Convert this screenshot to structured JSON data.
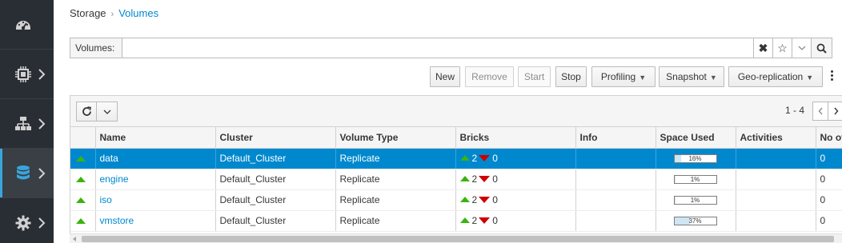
{
  "breadcrumb": {
    "parent": "Storage",
    "current": "Volumes"
  },
  "search": {
    "label": "Volumes:",
    "value": "",
    "placeholder": ""
  },
  "toolbar": {
    "new": "New",
    "remove": "Remove",
    "start": "Start",
    "stop": "Stop",
    "profiling": "Profiling",
    "snapshot": "Snapshot",
    "geo": "Geo-replication"
  },
  "pager": {
    "range": "1 - 4"
  },
  "columns": {
    "name": "Name",
    "cluster": "Cluster",
    "type": "Volume Type",
    "bricks": "Bricks",
    "info": "Info",
    "space": "Space Used",
    "activities": "Activities",
    "noof": "No of"
  },
  "rows": [
    {
      "name": "data",
      "cluster": "Default_Cluster",
      "type": "Replicate",
      "bricks_up": "2",
      "bricks_down": "0",
      "space": "16%",
      "space_fraction": 0.16,
      "noof": "0"
    },
    {
      "name": "engine",
      "cluster": "Default_Cluster",
      "type": "Replicate",
      "bricks_up": "2",
      "bricks_down": "0",
      "space": "1%",
      "space_fraction": 0.01,
      "noof": "0"
    },
    {
      "name": "iso",
      "cluster": "Default_Cluster",
      "type": "Replicate",
      "bricks_up": "2",
      "bricks_down": "0",
      "space": "1%",
      "space_fraction": 0.01,
      "noof": "0"
    },
    {
      "name": "vmstore",
      "cluster": "Default_Cluster",
      "type": "Replicate",
      "bricks_up": "2",
      "bricks_down": "0",
      "space": "37%",
      "space_fraction": 0.37,
      "noof": "0"
    }
  ],
  "colors": {
    "accent": "#0088ce",
    "nav": "#292e34",
    "up": "#3bb30f",
    "down": "#cc0000"
  }
}
